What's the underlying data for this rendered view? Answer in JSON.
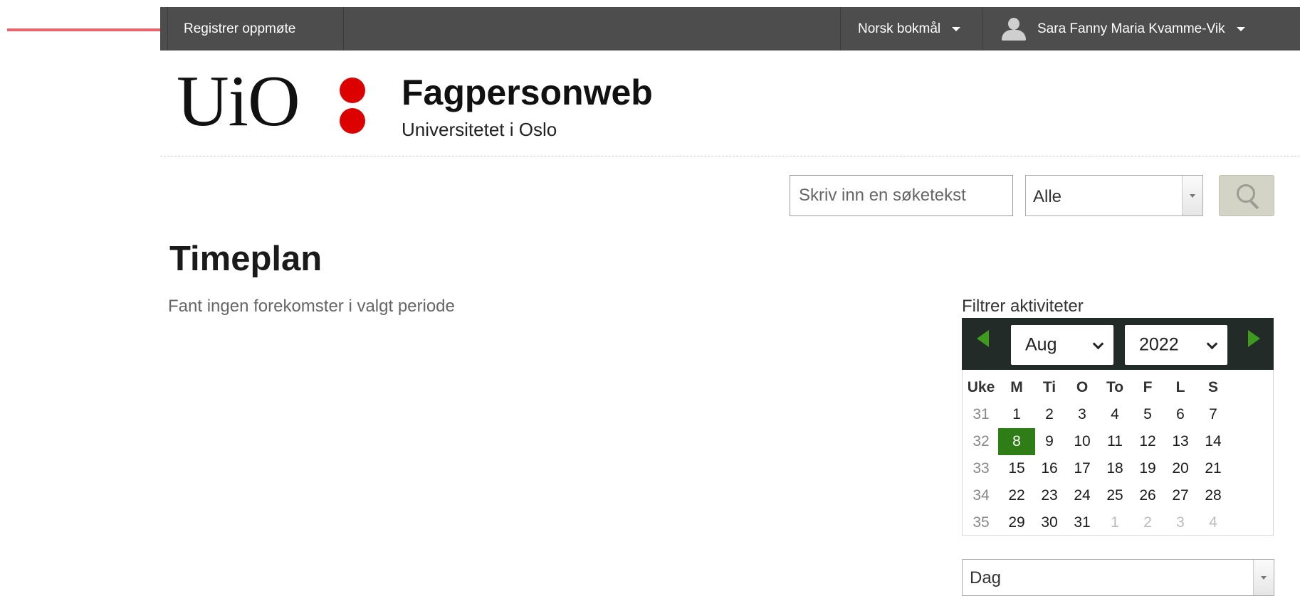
{
  "annotation": {
    "color": "#e8656b"
  },
  "topbar": {
    "register_label": "Registrer oppmøte",
    "language_label": "Norsk bokmål",
    "user_name": "Sara Fanny Maria Kvamme-Vik",
    "icons": [
      "user-icon",
      "caret-down-icon"
    ]
  },
  "header": {
    "logo_text": "UiO",
    "logo_dot_color": "#dd0000",
    "site_title": "Fagpersonweb",
    "site_subtitle": "Universitetet i Oslo"
  },
  "search": {
    "placeholder": "Skriv inn en søketekst",
    "scope_value": "Alle",
    "button_icon": "search-icon"
  },
  "main": {
    "title": "Timeplan",
    "empty_message": "Fant ingen forekomster i valgt periode"
  },
  "calendar": {
    "filter_label": "Filtrer aktiviteter",
    "month": "Aug",
    "year": "2022",
    "accent_color": "#3e9b1e",
    "selected_color": "#2f7d17",
    "headers": [
      "Uke",
      "M",
      "Ti",
      "O",
      "To",
      "F",
      "L",
      "S"
    ],
    "weeks": [
      {
        "week": "31",
        "days": [
          "1",
          "2",
          "3",
          "4",
          "5",
          "6",
          "7"
        ],
        "outside": []
      },
      {
        "week": "32",
        "days": [
          "8",
          "9",
          "10",
          "11",
          "12",
          "13",
          "14"
        ],
        "outside": []
      },
      {
        "week": "33",
        "days": [
          "15",
          "16",
          "17",
          "18",
          "19",
          "20",
          "21"
        ],
        "outside": []
      },
      {
        "week": "34",
        "days": [
          "22",
          "23",
          "24",
          "25",
          "26",
          "27",
          "28"
        ],
        "outside": []
      },
      {
        "week": "35",
        "days": [
          "29",
          "30",
          "31",
          "1",
          "2",
          "3",
          "4"
        ],
        "outside": [
          3,
          4,
          5,
          6
        ]
      }
    ],
    "selected_day": "8"
  },
  "view_select": {
    "value": "Dag"
  }
}
